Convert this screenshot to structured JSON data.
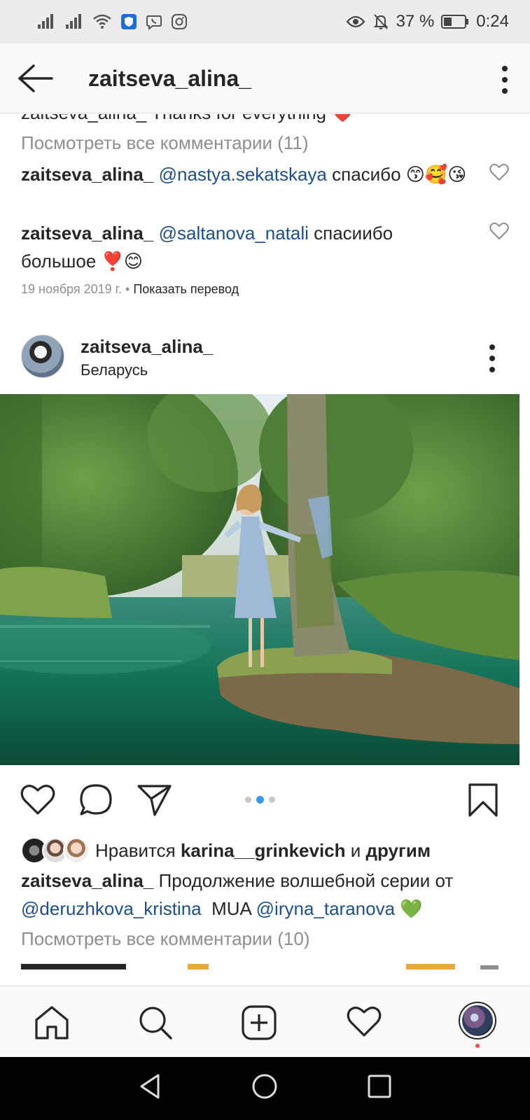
{
  "status_bar": {
    "battery_percent": "37 %",
    "time": "0:24"
  },
  "header": {
    "title": "zaitseva_alina_"
  },
  "comments_top": {
    "partial_line": "zaitseva_alina_ Thanks for everything ❤️",
    "view_all": "Посмотреть все комментарии (11)",
    "items": [
      {
        "user": "zaitseva_alina_",
        "mention": "@nastya.sekatskaya",
        "text": " спасибо 😙🥰😘"
      },
      {
        "user": "zaitseva_alina_",
        "mention": "@saltanova_natali",
        "text": " спасиибо большое ❣️😊"
      }
    ],
    "date": "19 ноября 2019 г.",
    "separator": " • ",
    "translate": "Показать перевод"
  },
  "post": {
    "username": "zaitseva_alina_",
    "location": "Беларусь",
    "carousel": {
      "count": 3,
      "active_index": 1
    },
    "likes": {
      "prefix": "Нравится ",
      "user": "karina__grinkevich",
      "mid": " и ",
      "others": "другим"
    },
    "caption": {
      "user": "zaitseva_alina_",
      "text": " Продолжение волшебной серии от ",
      "mention1": "@deruzhkova_kristina",
      "mid": "  MUA ",
      "mention2": "@iryna_taranova",
      "emoji": " 💚"
    },
    "view_all_comments": "Посмотреть все комментарии (10)"
  },
  "colors": {
    "mention": "#1b4f8f",
    "muted": "#8e8e8e",
    "accent_dot": "#3897f0",
    "notification": "#ed4956"
  },
  "icons": {
    "bottom_nav": [
      "home-icon",
      "search-icon",
      "add-post-icon",
      "activity-heart-icon",
      "profile-avatar"
    ],
    "actions": [
      "like-heart-icon",
      "comment-icon",
      "share-icon",
      "bookmark-icon"
    ]
  }
}
